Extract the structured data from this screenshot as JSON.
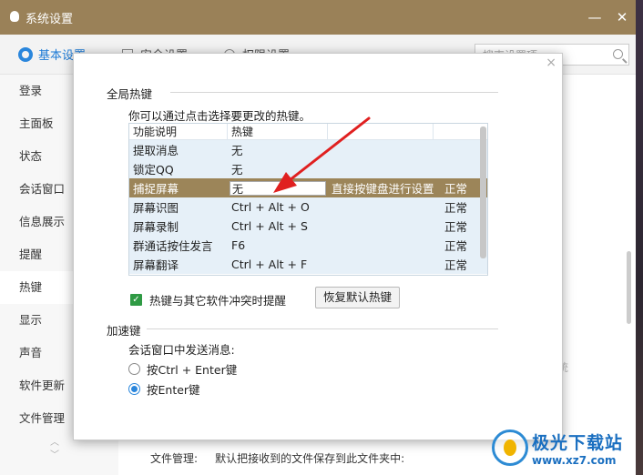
{
  "window": {
    "title": "系统设置",
    "minimize": "—",
    "close": "✕"
  },
  "tabs": [
    {
      "label": "基本设置",
      "icon": "gear-icon"
    },
    {
      "label": "安全设置",
      "icon": "shield-icon"
    },
    {
      "label": "权限设置",
      "icon": "lock-icon"
    }
  ],
  "search": {
    "placeholder": "搜索设置项"
  },
  "sidebar": {
    "items": [
      {
        "label": "登录"
      },
      {
        "label": "主面板"
      },
      {
        "label": "状态"
      },
      {
        "label": "会话窗口"
      },
      {
        "label": "信息展示"
      },
      {
        "label": "提醒"
      },
      {
        "label": "热键"
      },
      {
        "label": "显示"
      },
      {
        "label": "声音"
      },
      {
        "label": "软件更新"
      },
      {
        "label": "文件管理"
      }
    ],
    "active": "热键"
  },
  "behind": {
    "file_label": "文件管理:",
    "file_desc": "默认把接收到的文件保存到此文件夹中:",
    "side_text": "统"
  },
  "dialog": {
    "close": "×",
    "global_title": "全局热键",
    "desc": "你可以通过点击选择要更改的热键。",
    "table": {
      "headers": [
        "功能说明",
        "热键",
        "",
        ""
      ],
      "rows": [
        {
          "name": "提取消息",
          "key": "无",
          "note": "",
          "status": ""
        },
        {
          "name": "锁定QQ",
          "key": "无",
          "note": "",
          "status": ""
        },
        {
          "name": "捕捉屏幕",
          "key": "无",
          "note": "直接按键盘进行设置",
          "status": "正常",
          "selected": true
        },
        {
          "name": "屏幕识图",
          "key": "Ctrl + Alt + O",
          "note": "",
          "status": "正常"
        },
        {
          "name": "屏幕录制",
          "key": "Ctrl + Alt + S",
          "note": "",
          "status": "正常"
        },
        {
          "name": "群通话按住发言",
          "key": "F6",
          "note": "",
          "status": "正常"
        },
        {
          "name": "屏幕翻译",
          "key": "Ctrl + Alt + F",
          "note": "",
          "status": "正常"
        }
      ]
    },
    "conflict_checkbox": {
      "label": "热键与其它软件冲突时提醒",
      "checked": true
    },
    "restore_button": "恢复默认热键",
    "accel_title": "加速键",
    "accel_sub": "会话窗口中发送消息:",
    "radio_options": [
      {
        "label": "按Ctrl + Enter键",
        "checked": false
      },
      {
        "label": "按Enter键",
        "checked": true
      }
    ]
  },
  "watermark": {
    "name": "极光下载站",
    "url": "www.xz7.com"
  },
  "colors": {
    "title_bar": "#9a8158",
    "selected_row": "#9c8559",
    "accent": "#2a86dc",
    "arrow": "#e02020"
  }
}
